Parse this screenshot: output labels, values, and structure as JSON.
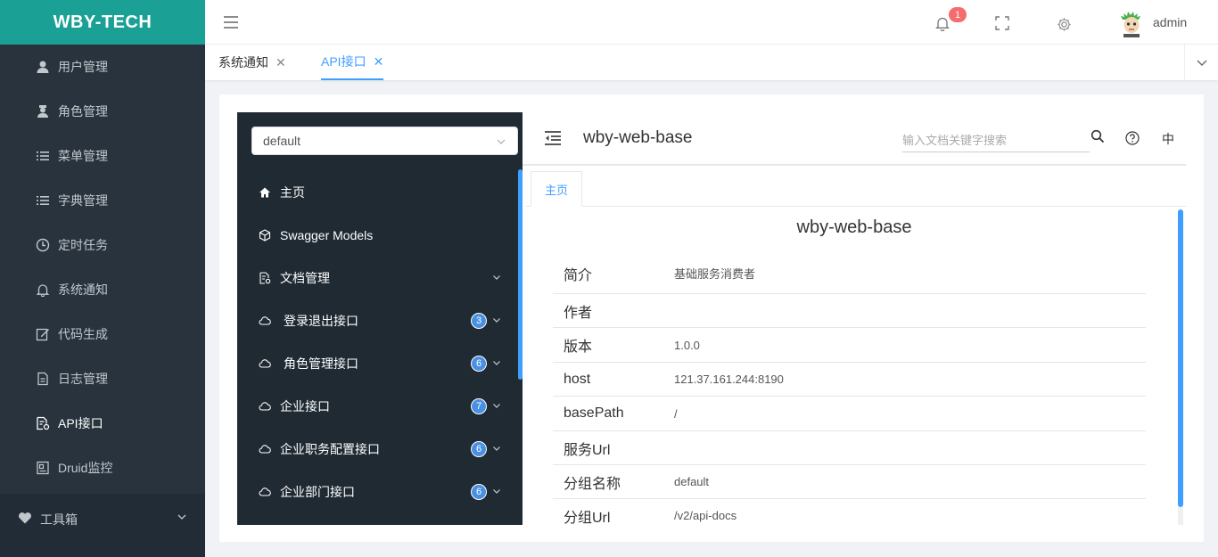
{
  "app": {
    "logo": "WBY-TECH"
  },
  "sidebar": {
    "items": [
      {
        "label": "用户管理",
        "icon": "user-icon"
      },
      {
        "label": "角色管理",
        "icon": "role-icon"
      },
      {
        "label": "菜单管理",
        "icon": "list-icon"
      },
      {
        "label": "字典管理",
        "icon": "list-icon"
      },
      {
        "label": "定时任务",
        "icon": "clock-icon"
      },
      {
        "label": "系统通知",
        "icon": "bell-icon"
      },
      {
        "label": "代码生成",
        "icon": "edit-icon"
      },
      {
        "label": "日志管理",
        "icon": "document-icon"
      },
      {
        "label": "API接口",
        "icon": "api-doc-icon",
        "active": true
      },
      {
        "label": "Druid监控",
        "icon": "monitor-icon"
      }
    ],
    "group": {
      "label": "工具箱",
      "icon": "heart-icon"
    }
  },
  "header": {
    "notification_count": "1",
    "username": "admin"
  },
  "tabs": [
    {
      "label": "系统通知",
      "close": "✕"
    },
    {
      "label": "API接口",
      "close": "✕",
      "active": true
    }
  ],
  "doc": {
    "group_select": "default",
    "menu": [
      {
        "label": "主页",
        "icon": "home-icon"
      },
      {
        "label": "Swagger Models",
        "icon": "models-icon"
      },
      {
        "label": "文档管理",
        "icon": "doc-manage-icon",
        "expandable": true
      },
      {
        "label": "登录退出接口",
        "icon": "cloud-icon",
        "count": "3"
      },
      {
        "label": "角色管理接口",
        "icon": "cloud-icon",
        "count": "6"
      },
      {
        "label": "企业接口",
        "icon": "cloud-icon",
        "count": "7"
      },
      {
        "label": "企业职务配置接口",
        "icon": "cloud-icon",
        "count": "6"
      },
      {
        "label": "企业部门接口",
        "icon": "cloud-icon",
        "count": "6"
      }
    ],
    "title": "wby-web-base",
    "search_placeholder": "输入文档关键字搜索",
    "lang": "中",
    "tab": "主页",
    "body_title": "wby-web-base",
    "info": [
      {
        "key": "简介",
        "value": "基础服务消费者"
      },
      {
        "key": "作者",
        "value": ""
      },
      {
        "key": "版本",
        "value": "1.0.0"
      },
      {
        "key": "host",
        "value": "121.37.161.244:8190"
      },
      {
        "key": "basePath",
        "value": "/"
      },
      {
        "key": "服务Url",
        "value": ""
      },
      {
        "key": "分组名称",
        "value": "default"
      },
      {
        "key": "分组Url",
        "value": "/v2/api-docs"
      }
    ]
  },
  "colors": {
    "logo_bg": "#1aa094",
    "sidebar_bg": "#28333e",
    "doc_sidebar_bg": "#1f2a33",
    "accent": "#409eff",
    "badge": "#f56c6c"
  }
}
